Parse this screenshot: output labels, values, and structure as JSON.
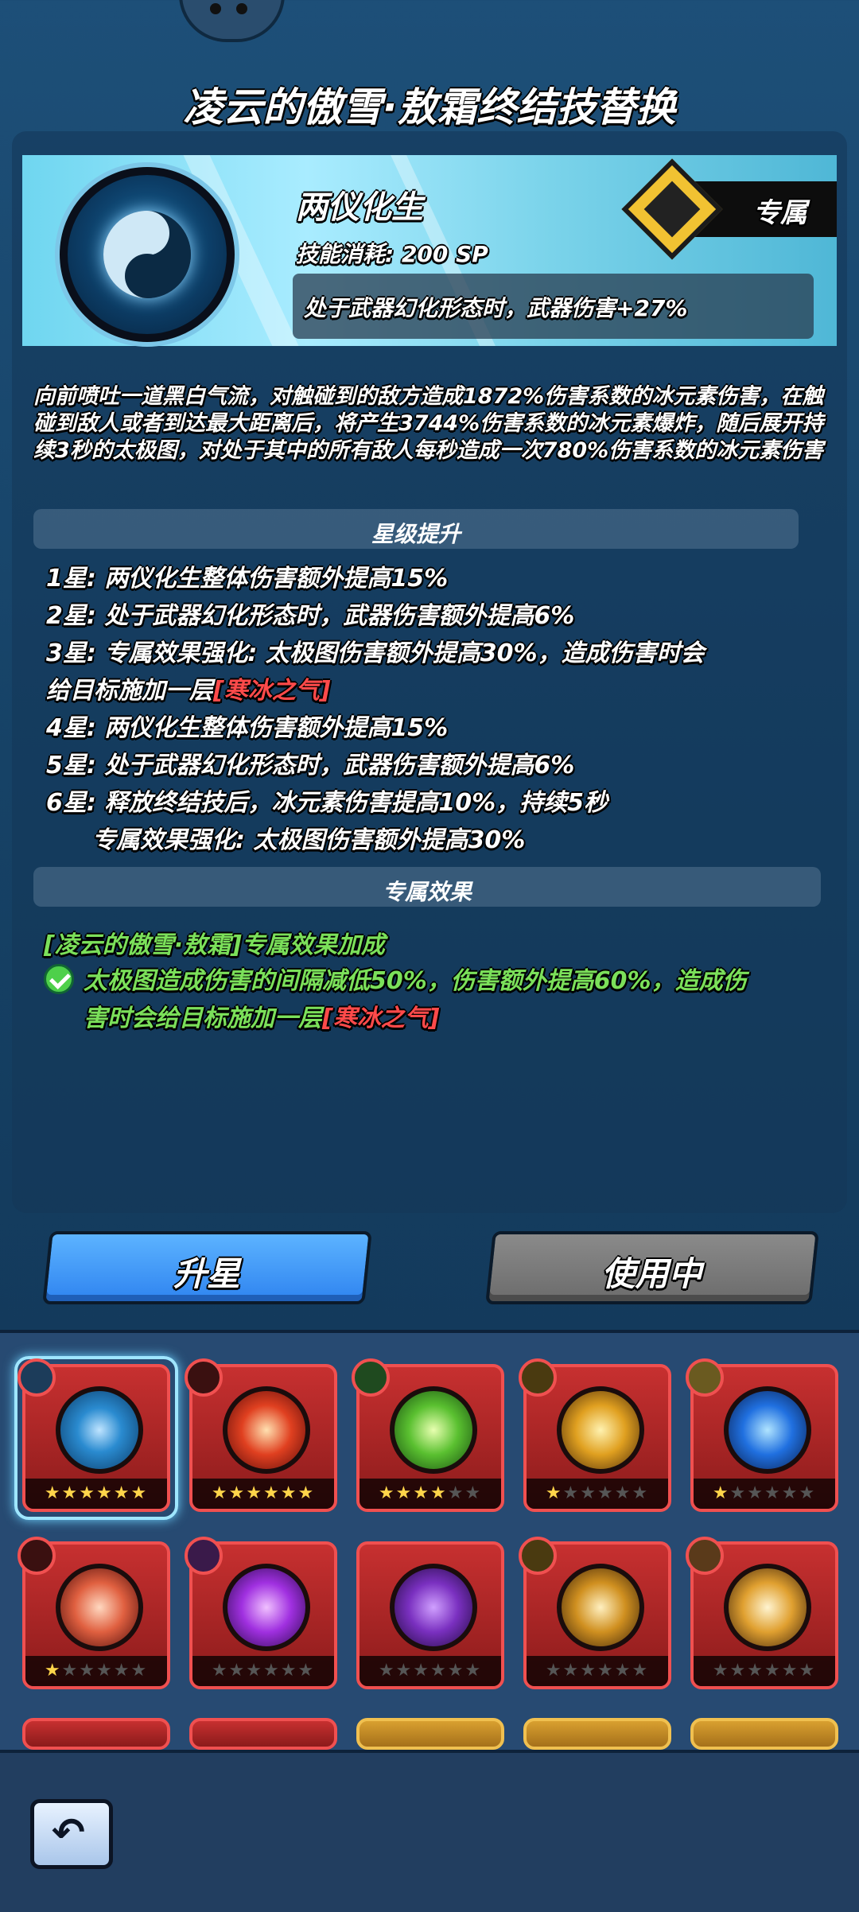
{
  "title": "凌云的傲雪·敖霜终结技替换",
  "skill": {
    "name": "两仪化生",
    "cost": "技能消耗: 200 SP",
    "effect": "处于武器幻化形态时，武器伤害+27%",
    "exclusive_label": "专属",
    "icon": "yin-yang-ice-icon"
  },
  "description": "向前喷吐一道黑白气流，对触碰到的敌方造成1872%伤害系数的冰元素伤害，在触碰到敌人或者到达最大距离后，将产生3744%伤害系数的冰元素爆炸，随后展开持续3秒的太极图，对处于其中的所有敌人每秒造成一次780%伤害系数的冰元素伤害",
  "star_section": {
    "title": "星级提升",
    "lines": [
      "1星: 两仪化生整体伤害额外提高15%",
      "2星: 处于武器幻化形态时，武器伤害额外提高6%",
      "3星: 专属效果强化: 太极图伤害额外提高30%，造成伤害时会",
      "给目标施加一层",
      "[寒冰之气]",
      "4星: 两仪化生整体伤害额外提高15%",
      "5星: 处于武器幻化形态时，武器伤害额外提高6%",
      "6星: 释放终结技后，冰元素伤害提高10%，持续5秒",
      "专属效果强化: 太极图伤害额外提高30%"
    ]
  },
  "exclusive_section": {
    "title": "专属效果",
    "header": "[凌云的傲雪·敖霜]专属效果加成",
    "line1": "太极图造成伤害的间隔减低50%，伤害额外提高60%，造成伤",
    "line2": "害时会给目标施加一层",
    "tag": "[寒冰之气]"
  },
  "buttons": {
    "upgrade": "升星",
    "in_use": "使用中"
  },
  "colors": {
    "accent_blue": "#2f84f0",
    "exclusive_green": "#7be05a",
    "highlight_red": "#ff4a4a",
    "star_gold": "#ffd54a"
  },
  "skill_grid": [
    {
      "name": "yin-yang-skill-icon",
      "stars": 6,
      "selected": true
    },
    {
      "name": "fire-burst-skill-icon",
      "stars": 6,
      "selected": false
    },
    {
      "name": "green-swirl-skill-icon",
      "stars": 4,
      "selected": false
    },
    {
      "name": "lightning-skill-icon",
      "stars": 1,
      "selected": false
    },
    {
      "name": "blue-flame-skill-icon",
      "stars": 1,
      "selected": false
    },
    {
      "name": "fire-planet-skill-icon",
      "stars": 1,
      "selected": false
    },
    {
      "name": "purple-orb-skill-icon",
      "stars": 0,
      "selected": false
    },
    {
      "name": "purple-cauldron-skill-icon",
      "stars": 0,
      "selected": false
    },
    {
      "name": "golden-figure-skill-icon",
      "stars": 0,
      "selected": false
    },
    {
      "name": "golden-slash-skill-icon",
      "stars": 0,
      "selected": false
    }
  ]
}
